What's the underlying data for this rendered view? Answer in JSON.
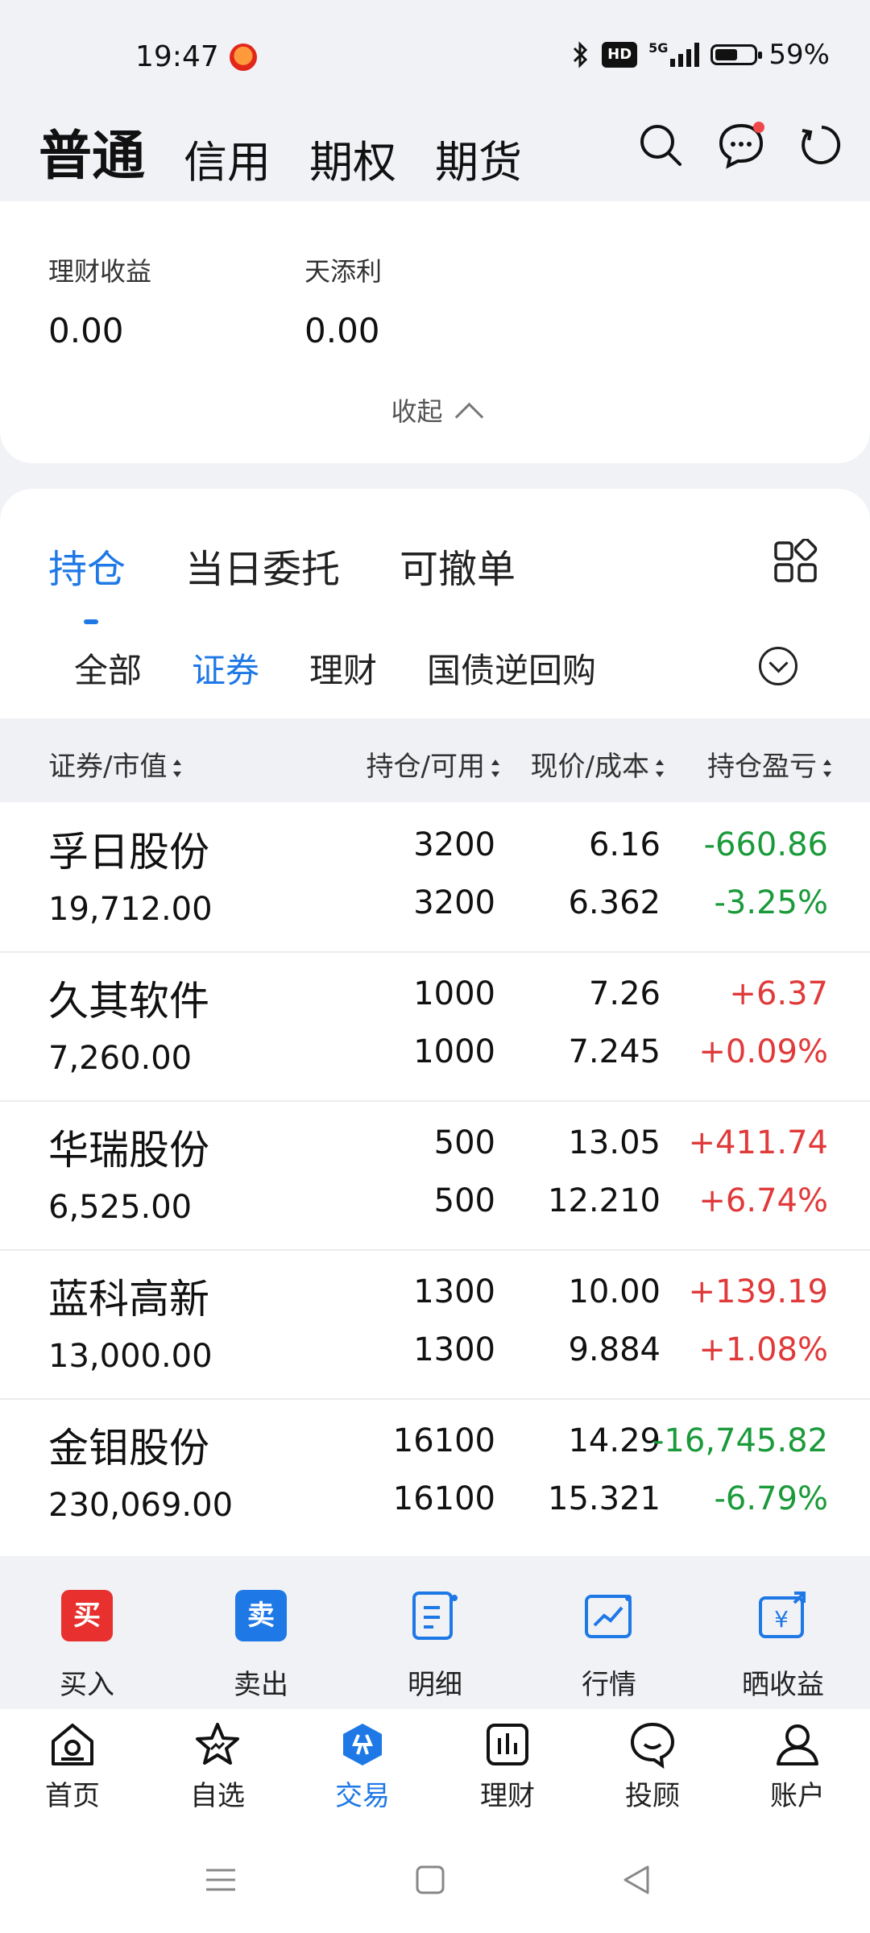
{
  "status": {
    "time": "19:47",
    "network": "5G",
    "hd": "HD",
    "battery_text": "59%",
    "battery_level": 0.59
  },
  "top_tabs": [
    "普通",
    "信用",
    "期权",
    "期货"
  ],
  "top_icons": [
    "search-icon",
    "message-icon",
    "refresh-icon"
  ],
  "finance": {
    "items": [
      {
        "label": "理财收益",
        "value": "0.00"
      },
      {
        "label": "天添利",
        "value": "0.00"
      }
    ],
    "collapse_label": "收起"
  },
  "position_tabs": [
    "持仓",
    "当日委托",
    "可撤单"
  ],
  "category_tabs": [
    "全部",
    "证券",
    "理财",
    "国债逆回购"
  ],
  "table": {
    "headers": [
      "证券/市值",
      "持仓/可用",
      "现价/成本",
      "持仓盈亏"
    ],
    "rows": [
      {
        "name": "孚日股份",
        "market_value": "19,712.00",
        "hold": "3200",
        "avail": "3200",
        "price": "6.16",
        "cost": "6.362",
        "pl": "-660.86",
        "pl_pct": "-3.25%"
      },
      {
        "name": "久其软件",
        "market_value": "7,260.00",
        "hold": "1000",
        "avail": "1000",
        "price": "7.26",
        "cost": "7.245",
        "pl": "+6.37",
        "pl_pct": "+0.09%"
      },
      {
        "name": "华瑞股份",
        "market_value": "6,525.00",
        "hold": "500",
        "avail": "500",
        "price": "13.05",
        "cost": "12.210",
        "pl": "+411.74",
        "pl_pct": "+6.74%"
      },
      {
        "name": "蓝科高新",
        "market_value": "13,000.00",
        "hold": "1300",
        "avail": "1300",
        "price": "10.00",
        "cost": "9.884",
        "pl": "+139.19",
        "pl_pct": "+1.08%"
      },
      {
        "name": "金钼股份",
        "market_value": "230,069.00",
        "hold": "16100",
        "avail": "16100",
        "price": "14.29",
        "cost": "15.321",
        "pl": "-16,745.82",
        "pl_pct": "-6.79%"
      }
    ]
  },
  "actions": [
    {
      "label": "买入",
      "glyph": "买"
    },
    {
      "label": "卖出",
      "glyph": "卖"
    },
    {
      "label": "明细"
    },
    {
      "label": "行情"
    },
    {
      "label": "晒收益"
    }
  ],
  "nav": [
    "首页",
    "自选",
    "交易",
    "理财",
    "投顾",
    "账户"
  ],
  "colors": {
    "accent": "#1e78e6",
    "gain": "#e03a3a",
    "loss": "#1a9a3a",
    "buy": "#e8302e"
  }
}
